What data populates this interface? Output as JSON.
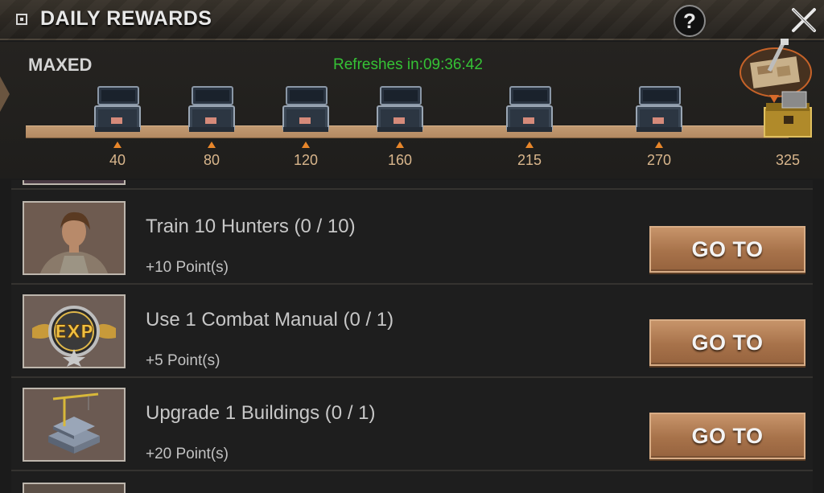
{
  "header": {
    "title": "DAILY REWARDS",
    "help_label": "?"
  },
  "progress": {
    "status": "MAXED",
    "refresh_text": "Refreshes in:09:36:42",
    "milestones": [
      "40",
      "80",
      "120",
      "160",
      "215",
      "270",
      "325"
    ]
  },
  "tasks": [
    {
      "title": "Train 10 Hunters (0 / 10)",
      "points": "+10 Point(s)",
      "button": "GO TO",
      "icon": "hunter-portrait-icon"
    },
    {
      "title": "Use 1 Combat Manual (0 / 1)",
      "points": "+5 Point(s)",
      "button": "GO TO",
      "icon": "exp-badge-icon"
    },
    {
      "title": "Upgrade 1 Buildings (0 / 1)",
      "points": "+20 Point(s)",
      "button": "GO TO",
      "icon": "construction-crane-icon"
    }
  ],
  "colors": {
    "refresh_green": "#35c235",
    "track_tan": "#c29a72",
    "milestone_orange": "#e8862a",
    "button_brown": "#a7724a"
  }
}
